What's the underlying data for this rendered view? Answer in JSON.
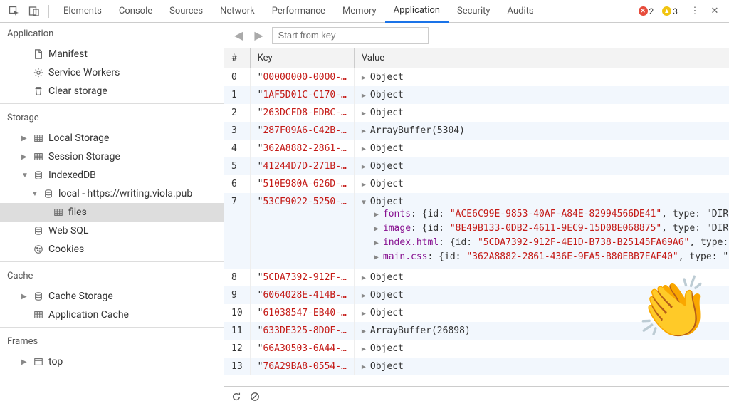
{
  "toolbar": {
    "tabs": [
      "Elements",
      "Console",
      "Sources",
      "Network",
      "Performance",
      "Memory",
      "Application",
      "Security",
      "Audits"
    ],
    "active_tab": "Application",
    "error_count": "2",
    "warning_count": "3"
  },
  "sidebar": {
    "sections": [
      {
        "header": "Application",
        "items": [
          {
            "indent": 1,
            "icon": "document",
            "label": "Manifest"
          },
          {
            "indent": 1,
            "icon": "gear",
            "label": "Service Workers"
          },
          {
            "indent": 1,
            "icon": "trash",
            "label": "Clear storage"
          }
        ]
      },
      {
        "header": "Storage",
        "items": [
          {
            "indent": 1,
            "twisty": "▶",
            "icon": "grid",
            "label": "Local Storage"
          },
          {
            "indent": 1,
            "twisty": "▶",
            "icon": "grid",
            "label": "Session Storage"
          },
          {
            "indent": 1,
            "twisty": "▼",
            "icon": "db",
            "label": "IndexedDB"
          },
          {
            "indent": 2,
            "twisty": "▼",
            "icon": "db",
            "label": "local - https://writing.viola.pub"
          },
          {
            "indent": 3,
            "icon": "grid",
            "label": "files",
            "selected": true
          },
          {
            "indent": 1,
            "icon": "db",
            "label": "Web SQL"
          },
          {
            "indent": 1,
            "icon": "cookie",
            "label": "Cookies"
          }
        ]
      },
      {
        "header": "Cache",
        "items": [
          {
            "indent": 1,
            "twisty": "▶",
            "icon": "db",
            "label": "Cache Storage"
          },
          {
            "indent": 1,
            "icon": "grid",
            "label": "Application Cache"
          }
        ]
      },
      {
        "header": "Frames",
        "items": [
          {
            "indent": 1,
            "twisty": "▶",
            "icon": "window",
            "label": "top"
          }
        ]
      }
    ]
  },
  "content": {
    "search_placeholder": "Start from key",
    "columns": [
      "#",
      "Key",
      "Value"
    ],
    "rows": [
      {
        "idx": "0",
        "key": "00000000-0000-…",
        "value": "Object"
      },
      {
        "idx": "1",
        "key": "1AF5D01C-C170-…",
        "value": "Object"
      },
      {
        "idx": "2",
        "key": "263DCFD8-EDBC-…",
        "value": "Object"
      },
      {
        "idx": "3",
        "key": "287F09A6-C42B-…",
        "value": "ArrayBuffer(5304)"
      },
      {
        "idx": "4",
        "key": "362A8882-2861-…",
        "value": "Object"
      },
      {
        "idx": "5",
        "key": "41244D7D-271B-…",
        "value": "Object"
      },
      {
        "idx": "6",
        "key": "510E980A-626D-…",
        "value": "Object"
      },
      {
        "idx": "7",
        "key": "53CF9022-5250-…",
        "value": "Object",
        "expanded": true,
        "children": [
          {
            "prop": "fonts",
            "id": "ACE6C99E-9853-40AF-A84E-82994566DE41",
            "tail": ", type: \"DIR"
          },
          {
            "prop": "image",
            "id": "8E49B133-0DB2-4611-9EC9-15D08E068875",
            "tail": ", type: \"DIR"
          },
          {
            "prop": "index.html",
            "id": "5CDA7392-912F-4E1D-B738-B25145FA69A6",
            "tail": ", type:"
          },
          {
            "prop": "main.css",
            "id": "362A8882-2861-436E-9FA5-B80EBB7EAF40",
            "tail": ", type: \""
          }
        ]
      },
      {
        "idx": "8",
        "key": "5CDA7392-912F-…",
        "value": "Object"
      },
      {
        "idx": "9",
        "key": "6064028E-414B-…",
        "value": "Object"
      },
      {
        "idx": "10",
        "key": "61038547-EB40-…",
        "value": "Object"
      },
      {
        "idx": "11",
        "key": "633DE325-8D0F-…",
        "value": "ArrayBuffer(26898)"
      },
      {
        "idx": "12",
        "key": "66A30503-6A44-…",
        "value": "Object"
      },
      {
        "idx": "13",
        "key": "76A29BA8-0554-…",
        "value": "Object"
      }
    ]
  },
  "emoji": "👏"
}
